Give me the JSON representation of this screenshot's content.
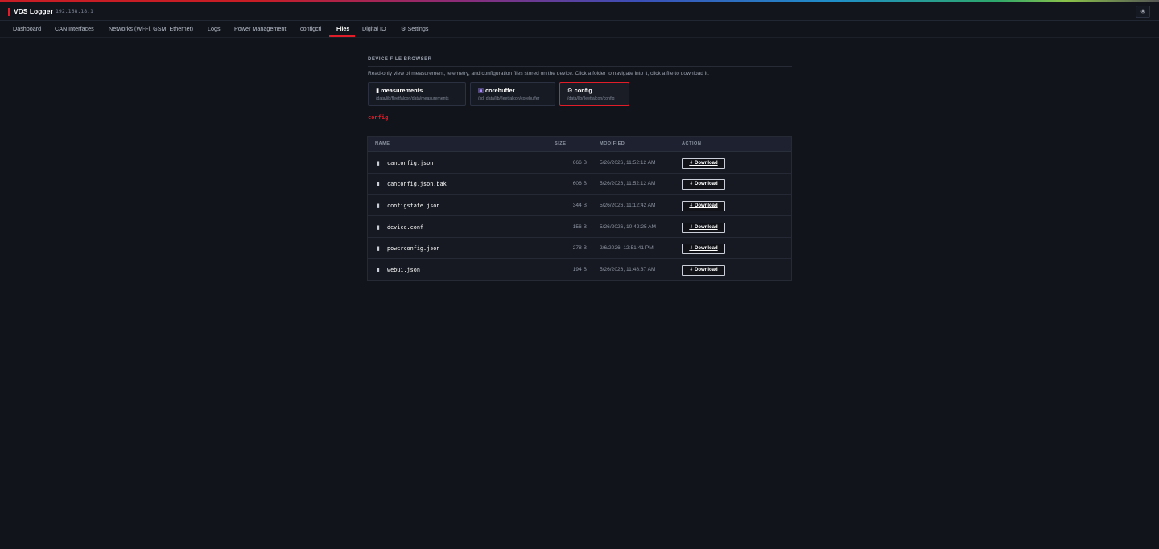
{
  "app": {
    "title": "VDS Logger",
    "ip": "192.168.18.1",
    "theme_button_icon": "sun-icon",
    "theme_button_glyph": "✳"
  },
  "colors": {
    "accent": "#e11d2a",
    "background": "#11141b"
  },
  "nav": {
    "items": [
      {
        "label": "Dashboard"
      },
      {
        "label": "CAN Interfaces"
      },
      {
        "label": "Networks (Wi-Fi, GSM, Ethernet)"
      },
      {
        "label": "Logs"
      },
      {
        "label": "Power Management"
      },
      {
        "label": "configctl"
      },
      {
        "label": "Files"
      },
      {
        "label": "Digital IO"
      },
      {
        "label": "⚙ Settings"
      }
    ],
    "active": "Files"
  },
  "browser": {
    "title": "DEVICE FILE BROWSER",
    "description": "Read-only view of measurement, telemetry, and configuration files stored on the device. Click a folder to navigate into it, click a file to download it.",
    "folders": [
      {
        "icon": "document-icon",
        "glyph": "▮",
        "name": "measurements",
        "path": "/data/lib/fleetfalcon/data/measurements"
      },
      {
        "icon": "archive-icon",
        "glyph": "▣",
        "name": "corebuffer",
        "path": "/sd_data/lib/fleetfalcon/corebuffer"
      },
      {
        "icon": "gear-icon",
        "glyph": "⚙",
        "name": "config",
        "path": "/data/lib/fleetfalcon/config"
      }
    ],
    "active_folder": "config",
    "breadcrumb": "config"
  },
  "table": {
    "headers": {
      "name": "NAME",
      "size": "SIZE",
      "modified": "MODIFIED",
      "action": "ACTION"
    },
    "download_label": "⇩ Download",
    "file_glyph": "▮",
    "rows": [
      {
        "name": "canconfig.json",
        "size": "666 B",
        "modified": "5/26/2026, 11:52:12 AM"
      },
      {
        "name": "canconfig.json.bak",
        "size": "606 B",
        "modified": "5/26/2026, 11:52:12 AM"
      },
      {
        "name": "configstate.json",
        "size": "344 B",
        "modified": "5/26/2026, 11:12:42 AM"
      },
      {
        "name": "device.conf",
        "size": "156 B",
        "modified": "5/26/2026, 10:42:25 AM"
      },
      {
        "name": "powerconfig.json",
        "size": "278 B",
        "modified": "2/6/2026, 12:51:41 PM"
      },
      {
        "name": "webui.json",
        "size": "194 B",
        "modified": "5/26/2026, 11:48:37 AM"
      }
    ]
  }
}
